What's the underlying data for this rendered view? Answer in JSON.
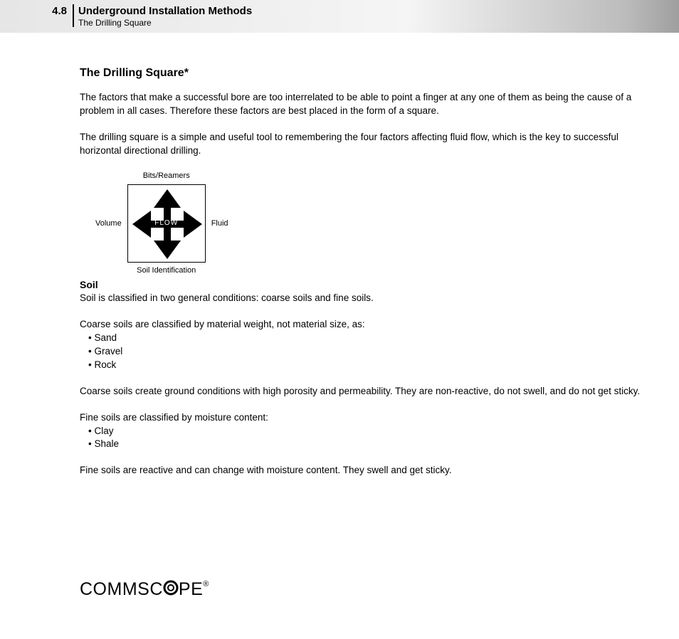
{
  "header": {
    "page_number": "4.8",
    "chapter": "Underground Installation Methods",
    "section": "The Drilling Square"
  },
  "main": {
    "title": "The Drilling Square*",
    "p1": "The factors that make a successful bore are too interrelated to be able to point a finger at any one of them as being the cause of a problem in all cases. Therefore these factors are best placed in the form of a square.",
    "p2": "The drilling square is a simple and useful tool to remembering the four factors affecting fluid flow, which is the key to successful horizontal directional drilling.",
    "diagram": {
      "top": "Bits/Reamers",
      "left": "Volume",
      "right": "Fluid",
      "bottom": "Soil Identification",
      "center": "FLOW"
    },
    "soil": {
      "heading": "Soil",
      "p1": "Soil is classified in two general conditions: coarse soils and fine soils.",
      "p2": "Coarse soils are classified by material weight, not material size, as:",
      "coarse_list": [
        "Sand",
        "Gravel",
        "Rock"
      ],
      "p3": "Coarse soils create ground conditions with high porosity and permeability. They are non-reactive, do not swell, and do not get sticky.",
      "p4": "Fine soils are classified by moisture content:",
      "fine_list": [
        "Clay",
        "Shale"
      ],
      "p5": "Fine soils are reactive and can change with moisture content. They swell and get sticky."
    }
  },
  "logo": {
    "pre": "COMMSC",
    "post": "PE",
    "reg": "®"
  }
}
